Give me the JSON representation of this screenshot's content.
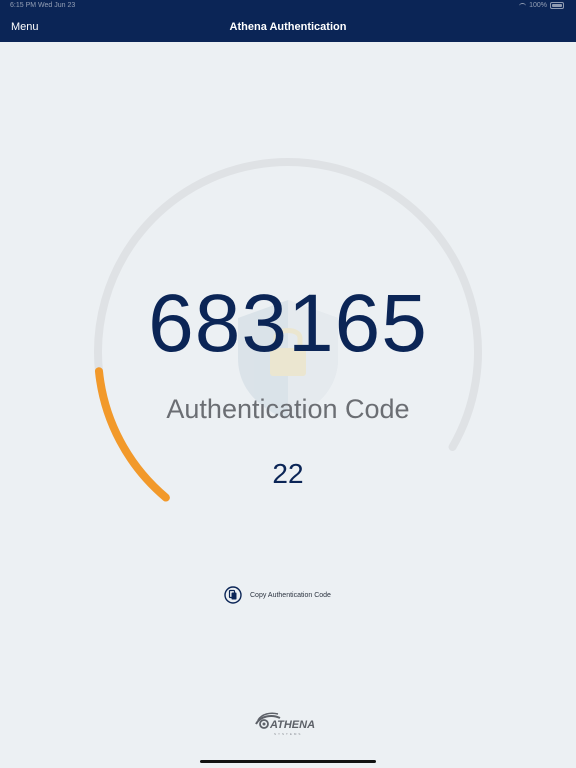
{
  "status_bar": {
    "time_date": "6:15 PM   Wed Jun 23",
    "battery": "100%",
    "battery_level": 1.0
  },
  "nav": {
    "menu_label": "Menu",
    "title": "Athena Authentication"
  },
  "auth": {
    "code": "683165",
    "label": "Authentication Code",
    "seconds_remaining": "22",
    "progress_fraction": 0.17,
    "progress_color": "#f2992a",
    "track_color": "#dfe2e5"
  },
  "copy": {
    "label": "Copy Authentication Code",
    "icon": "copy-icon"
  },
  "footer": {
    "logo_text": "ATHENA",
    "logo_subtext": "SYSTEMS"
  },
  "colors": {
    "nav_background": "#0b2556",
    "page_background": "#ecf0f3",
    "code_color": "#0b2556",
    "label_color": "#6b6e73"
  }
}
